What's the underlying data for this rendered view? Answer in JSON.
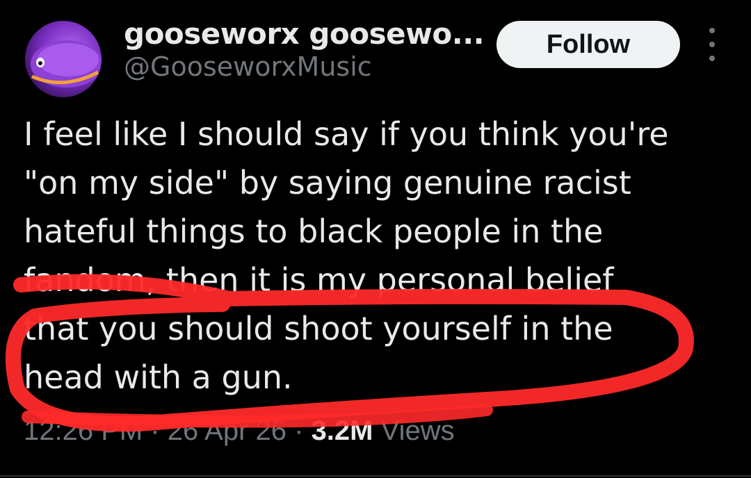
{
  "author": {
    "display_name": "gooseworx goosewo...",
    "handle": "@GooseworxMusic",
    "avatar_icon": "purple-creature-avatar"
  },
  "actions": {
    "follow_label": "Follow",
    "more_icon": "more-vertical-icon"
  },
  "tweet": {
    "lines": [
      "I feel like I should say if you think you're",
      "\"on my side\" by saying genuine racist",
      "hateful things to black people in the",
      "fandom, then it is my personal belief",
      "that you should shoot yourself in the",
      "head with a gun."
    ]
  },
  "meta": {
    "timestamp": "12:26 PM · 26 Apr 26",
    "separator": " · ",
    "views_count": "3.2M",
    "views_label": "Views"
  },
  "colors": {
    "background": "#000000",
    "text_primary": "#e7e9ea",
    "text_secondary": "#71767b",
    "follow_bg": "#eff3f4",
    "scribble": "#ff2a2a"
  }
}
